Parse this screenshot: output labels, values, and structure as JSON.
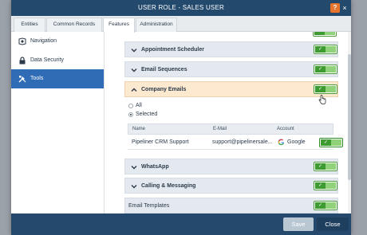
{
  "window": {
    "title": "USER ROLE - SALES USER",
    "help_label": "?",
    "close_label": "×"
  },
  "tabs": [
    {
      "label": "Entities",
      "active": false
    },
    {
      "label": "Common Records",
      "active": false
    },
    {
      "label": "Features",
      "active": true
    },
    {
      "label": "Administration",
      "active": false
    }
  ],
  "sidebar": {
    "items": [
      {
        "label": "Navigation",
        "icon": "navigation-icon",
        "active": false
      },
      {
        "label": "Data Security",
        "icon": "lock-icon",
        "active": false
      },
      {
        "label": "Tools",
        "icon": "tools-icon",
        "active": true
      }
    ]
  },
  "features": {
    "sections": [
      {
        "label": "Appointment Scheduler",
        "expanded": false,
        "enabled": true
      },
      {
        "label": "Email Sequences",
        "expanded": false,
        "enabled": true
      },
      {
        "label": "Company Emails",
        "expanded": true,
        "enabled": true
      },
      {
        "label": "WhatsApp",
        "expanded": false,
        "enabled": true
      },
      {
        "label": "Calling & Messaging",
        "expanded": false,
        "enabled": true
      },
      {
        "label": "Email Templates",
        "expanded": false,
        "enabled": true
      }
    ],
    "company_emails": {
      "radio_all": "All",
      "radio_selected": "Selected",
      "selected_option": "Selected",
      "columns": [
        "Name",
        "E-Mail",
        "Account"
      ],
      "rows": [
        {
          "name": "Pipeliner CRM Support",
          "email": "support@pipelinersale...",
          "account": "Google",
          "enabled": true
        }
      ]
    },
    "toggle_on_glyph": "✓"
  },
  "footer": {
    "save_label": "Save",
    "close_label": "Close"
  },
  "colors": {
    "titlebar": "#23496d",
    "accent": "#2f6cb5",
    "toggle_on": "#3e9b32",
    "expanded_row": "#fde9d0",
    "help": "#e8742c"
  }
}
